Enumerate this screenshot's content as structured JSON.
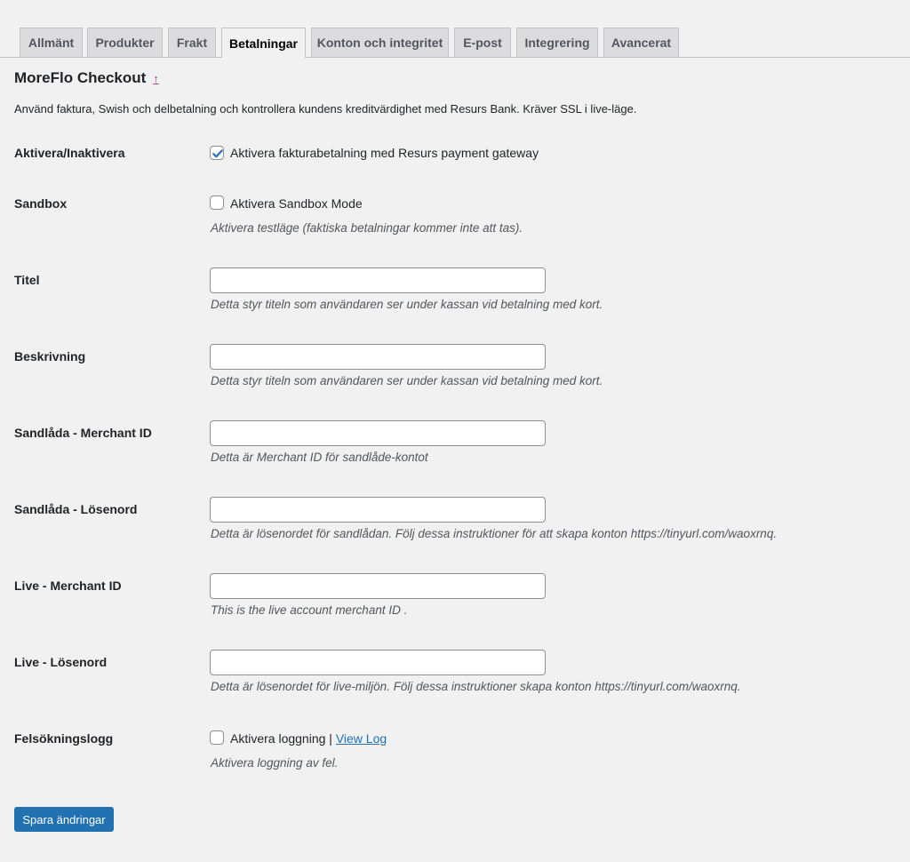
{
  "tabs": [
    {
      "label": "Allmänt",
      "active": false
    },
    {
      "label": "Produkter",
      "active": false
    },
    {
      "label": "Frakt",
      "active": false
    },
    {
      "label": "Betalningar",
      "active": true
    },
    {
      "label": "Konton och integritet",
      "active": false
    },
    {
      "label": "E-post",
      "active": false
    },
    {
      "label": "Integrering",
      "active": false
    },
    {
      "label": "Avancerat",
      "active": false
    }
  ],
  "header": {
    "title": "MoreFlo Checkout",
    "up_icon": "↑",
    "description": "Använd faktura, Swish och delbetalning och kontrollera kundens kreditvärdighet med Resurs Bank. Kräver SSL i live-läge."
  },
  "fields": {
    "enable": {
      "label": "Aktivera/Inaktivera",
      "checkbox_label": "Aktivera fakturabetalning med Resurs payment gateway",
      "checked": true
    },
    "sandbox": {
      "label": "Sandbox",
      "checkbox_label": "Aktivera Sandbox Mode",
      "checked": false,
      "description": "Aktivera testläge (faktiska betalningar kommer inte att tas)."
    },
    "title": {
      "label": "Titel",
      "value": "",
      "description": "Detta styr titeln som användaren ser under kassan vid betalning med kort."
    },
    "description": {
      "label": "Beskrivning",
      "value": "",
      "description": "Detta styr titeln som användaren ser under kassan vid betalning med kort."
    },
    "sandbox_merchant_id": {
      "label": "Sandlåda - Merchant ID",
      "value": "",
      "description": "Detta är Merchant ID för sandlåde-kontot"
    },
    "sandbox_password": {
      "label": "Sandlåda - Lösenord",
      "value": "",
      "description": "Detta är lösenordet för sandlådan. Följ dessa instruktioner för att skapa konton https://tinyurl.com/waoxrnq."
    },
    "live_merchant_id": {
      "label": "Live - Merchant ID",
      "value": "",
      "description": "This is the live account merchant ID ."
    },
    "live_password": {
      "label": "Live - Lösenord",
      "value": "",
      "description": "Detta är lösenordet för live-miljön. Följ dessa instruktioner skapa konton https://tinyurl.com/waoxrnq."
    },
    "debug": {
      "label": "Felsökningslogg",
      "checkbox_label": "Aktivera loggning |",
      "link_label": "View Log",
      "checked": false,
      "description": "Aktivera loggning av fel."
    }
  },
  "save_button": "Spara ändringar",
  "colors": {
    "accent": "#2271b1",
    "background": "#f1f1f1",
    "link_icon": "#a9408b"
  }
}
